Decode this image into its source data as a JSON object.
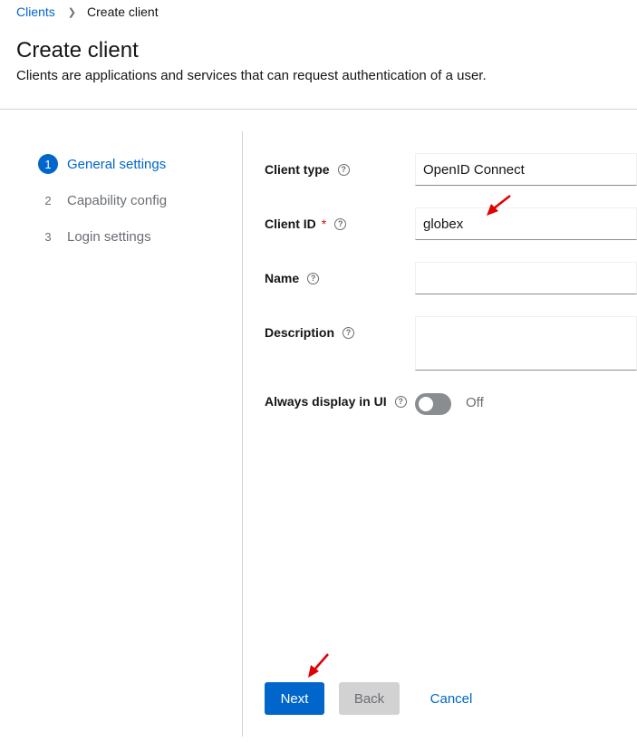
{
  "breadcrumb": {
    "parent": "Clients",
    "current": "Create client"
  },
  "page": {
    "title": "Create client",
    "description": "Clients are applications and services that can request authentication of a user."
  },
  "wizard": {
    "steps": [
      {
        "number": "1",
        "label": "General settings",
        "active": true
      },
      {
        "number": "2",
        "label": "Capability config",
        "active": false
      },
      {
        "number": "3",
        "label": "Login settings",
        "active": false
      }
    ]
  },
  "form": {
    "client_type": {
      "label": "Client type",
      "value": "OpenID Connect"
    },
    "client_id": {
      "label": "Client ID",
      "required_mark": "*",
      "value": "globex"
    },
    "name": {
      "label": "Name",
      "value": ""
    },
    "description": {
      "label": "Description",
      "value": ""
    },
    "always_display": {
      "label": "Always display in UI",
      "state_label": "Off",
      "on": false
    }
  },
  "icons": {
    "help": "question-circle-icon",
    "breadcrumb_separator": "chevron-right-icon",
    "annotation": "red-arrow-icon"
  },
  "buttons": {
    "next": "Next",
    "back": "Back",
    "cancel": "Cancel"
  },
  "colors": {
    "primary": "#0066cc",
    "annotation": "#e00000",
    "required": "#c9190b"
  }
}
